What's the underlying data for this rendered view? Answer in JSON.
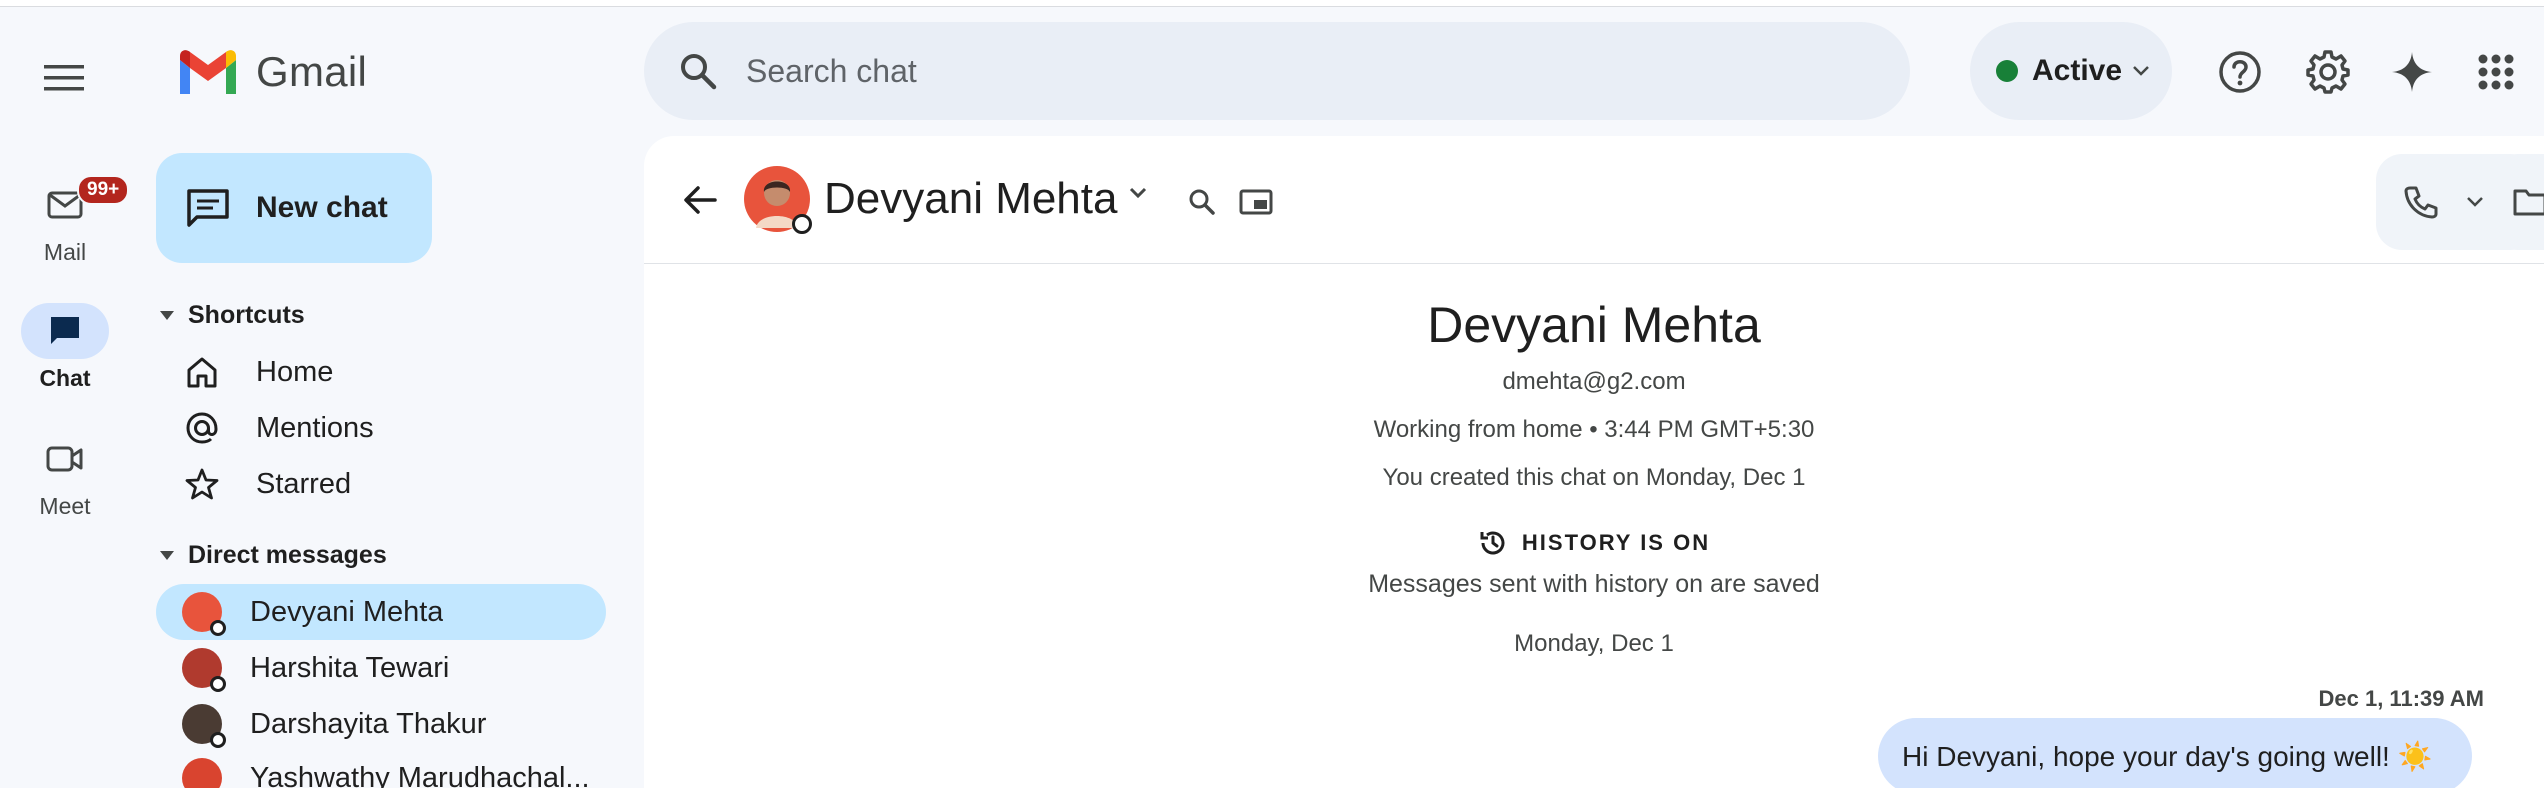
{
  "app": {
    "name": "Gmail",
    "accent": "#c2e7ff",
    "surface": "#f6f8fc"
  },
  "rail": {
    "items": [
      {
        "label": "Mail",
        "icon": "mail-icon",
        "badge": "99+"
      },
      {
        "label": "Chat",
        "icon": "chat-icon",
        "active": true
      },
      {
        "label": "Meet",
        "icon": "video-camera-icon"
      }
    ]
  },
  "header": {
    "search_placeholder": "Search chat",
    "status_label": "Active",
    "status_color": "#188038",
    "icons": [
      "help-icon",
      "settings-icon",
      "gemini-sparkle-icon",
      "apps-grid-icon"
    ]
  },
  "sidebar": {
    "new_chat_label": "New chat",
    "shortcuts_title": "Shortcuts",
    "shortcuts": [
      {
        "label": "Home",
        "icon": "home-icon"
      },
      {
        "label": "Mentions",
        "icon": "at-sign-icon"
      },
      {
        "label": "Starred",
        "icon": "star-icon"
      }
    ],
    "dm_title": "Direct messages",
    "direct_messages": [
      {
        "name": "Devyani Mehta",
        "active": true
      },
      {
        "name": "Harshita Tewari"
      },
      {
        "name": "Darshayita Thakur"
      },
      {
        "name": "Yashwathy Marudhachal..."
      }
    ]
  },
  "conversation": {
    "name": "Devyani Mehta",
    "intro_name": "Devyani Mehta",
    "email": "dmehta@g2.com",
    "status_line": "Working from home • 3:44 PM GMT+5:30",
    "created_line": "You created this chat on Monday, Dec 1",
    "history_label": "HISTORY IS ON",
    "history_sub": "Messages sent with history on are saved",
    "date_separator": "Monday, Dec 1",
    "messages": [
      {
        "time": "Dec 1, 11:39 AM",
        "text": "Hi Devyani, hope your day's going well! ☀️"
      }
    ]
  }
}
